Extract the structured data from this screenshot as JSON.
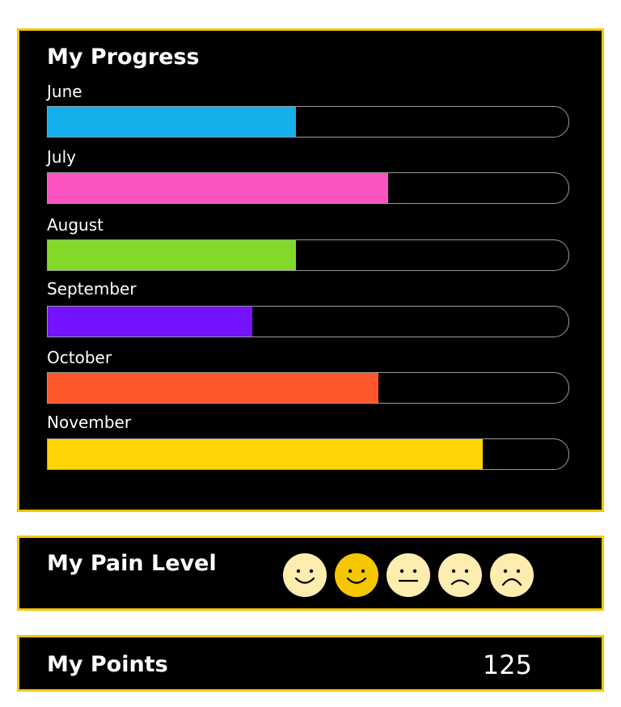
{
  "progress": {
    "title": "My Progress",
    "bars": [
      {
        "label": "June",
        "value": 0.477,
        "color": "#15b0ec"
      },
      {
        "label": "July",
        "value": 0.653,
        "color": "#fb53bf"
      },
      {
        "label": "August",
        "value": 0.477,
        "color": "#82d92a"
      },
      {
        "label": "September",
        "value": 0.393,
        "color": "#7512fe"
      },
      {
        "label": "October",
        "value": 0.635,
        "color": "#ff572b"
      },
      {
        "label": "November",
        "value": 0.835,
        "color": "#ffd505"
      }
    ]
  },
  "pain": {
    "title": "My Pain Level",
    "faces": [
      {
        "icon": "happy-face-icon",
        "selected": false
      },
      {
        "icon": "happy-face-icon",
        "selected": true
      },
      {
        "icon": "neutral-face-icon",
        "selected": false
      },
      {
        "icon": "sad-face-icon",
        "selected": false
      },
      {
        "icon": "sad-face-icon",
        "selected": false
      }
    ],
    "face_color": "#fdeeb0",
    "selected_color": "#f5c700"
  },
  "points": {
    "title": "My Points",
    "value": "125"
  },
  "colors": {
    "panel_border": "#f5c700",
    "panel_bg": "#000000"
  }
}
